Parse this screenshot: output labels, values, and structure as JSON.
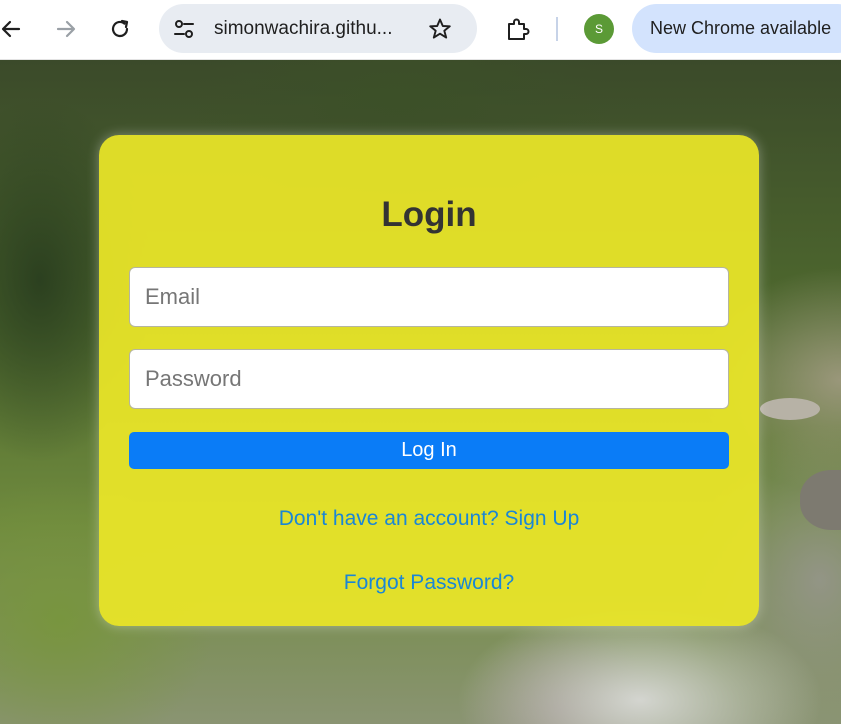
{
  "browser": {
    "url": "simonwachira.githu...",
    "avatar_initial": "S",
    "update_chip_label": "New Chrome available",
    "icons": [
      "back-arrow-icon",
      "forward-arrow-icon",
      "reload-icon",
      "site-settings-icon",
      "bookmark-star-icon",
      "extensions-puzzle-icon"
    ],
    "avatar_color": "#5b9a36"
  },
  "login": {
    "title": "Login",
    "email_placeholder": "Email",
    "password_placeholder": "Password",
    "submit_label": "Log In",
    "signup_link": "Don't have an account? Sign Up",
    "forgot_link": "Forgot Password?"
  },
  "colors": {
    "card_background": "#ebe628",
    "button_background": "#0a7cf7",
    "link_color": "#1a86d6",
    "title_color": "#333333"
  }
}
